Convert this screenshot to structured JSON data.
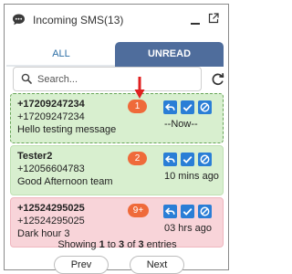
{
  "window": {
    "title": "Incoming SMS(13)",
    "icons": {
      "app": "chat-bubble-icon",
      "minimize": "minimize-icon",
      "popout": "popout-icon"
    }
  },
  "tabs": [
    {
      "label": "ALL",
      "active": false
    },
    {
      "label": "UNREAD",
      "active": true
    }
  ],
  "search": {
    "placeholder": "Search...",
    "value": ""
  },
  "messages": [
    {
      "sender": "+17209247234",
      "number": "+17209247234",
      "text": "Hello testing message",
      "badge": "1",
      "time": "--Now--",
      "color": "green"
    },
    {
      "sender": "Tester2",
      "number": "+12056604783",
      "text": "Good Afternoon team",
      "badge": "2",
      "time": "10 mins ago",
      "color": "green"
    },
    {
      "sender": "+12524295025",
      "number": "+12524295025",
      "text": "Dark hour 3",
      "badge": "9+",
      "time": "03 hrs ago",
      "color": "red"
    }
  ],
  "actions": {
    "reply": "reply-icon",
    "mark_read": "check-icon",
    "block": "block-icon"
  },
  "pagination": {
    "prefix": "Showing ",
    "from": "1",
    "mid1": " to ",
    "to": "3",
    "mid2": " of ",
    "total": "3",
    "suffix": " entries",
    "prev_label": "Prev",
    "next_label": "Next"
  },
  "colors": {
    "tab_active": "#4f6d9c",
    "badge": "#ef6a3a",
    "action": "#2a7ed6",
    "arrow": "#e02020",
    "card_green": "#d8efcf",
    "card_red": "#f8d4d9"
  }
}
